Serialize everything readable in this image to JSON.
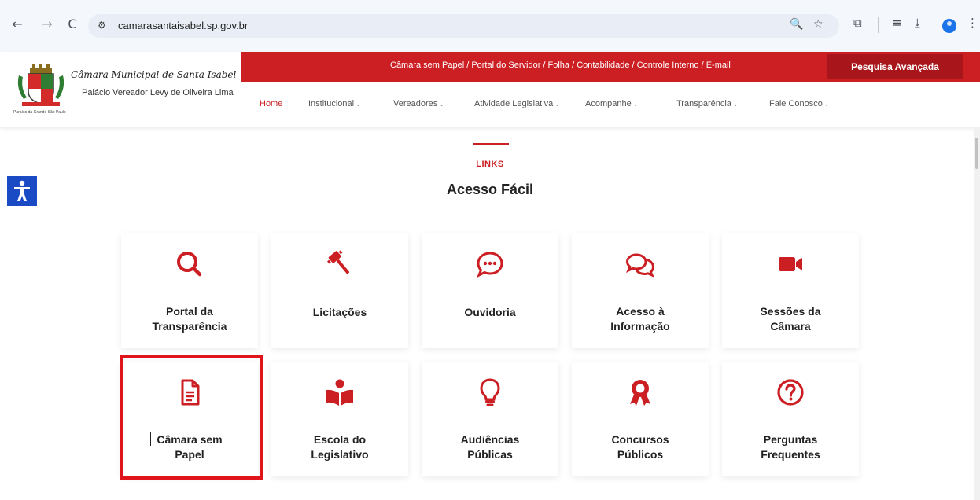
{
  "browser": {
    "url": "camarasantaisabel.sp.gov.br",
    "back_icon": "←",
    "forward_icon": "→",
    "reload_icon": "C",
    "site_info_icon": "⚙",
    "zoom_icon": "🔍",
    "star_icon": "☆",
    "extensions_icon": "⧉",
    "media_icon": "≡",
    "download_icon": "⤓",
    "menu_icon": "⋮"
  },
  "site": {
    "org_name": "Câmara Municipal de Santa Isabel",
    "org_sub": "Palácio Vereador Levy de Oliveira Lima",
    "crest_caption": "Paraíso da Grande São Paulo",
    "top_links": "Câmara sem Papel  /  Portal do Servidor  /  Folha  /  Contabilidade  /  Controle Interno  /  E-mail",
    "advanced_search": "Pesquisa Avançada",
    "nav": [
      {
        "label": "Home",
        "active": true
      },
      {
        "label": "Institucional",
        "caret": "⌄"
      },
      {
        "label": "Vereadores",
        "caret": "⌄"
      },
      {
        "label": "Atividade Legislativa",
        "caret": "⌄"
      },
      {
        "label": "Acompanhe",
        "caret": "⌄"
      },
      {
        "label": "Transparência",
        "caret": "⌄"
      },
      {
        "label": "Fale Conosco",
        "caret": "⌄"
      }
    ],
    "brand_color": "#cc1f24"
  },
  "section": {
    "eyebrow": "LINKS",
    "title": "Acesso Fácil"
  },
  "cards": [
    {
      "label": "Portal da\nTransparência",
      "icon": "search-icon"
    },
    {
      "label": "Licitações",
      "icon": "gavel-icon"
    },
    {
      "label": "Ouvidoria",
      "icon": "chat-dots-icon"
    },
    {
      "label": "Acesso à\nInformação",
      "icon": "comments-icon"
    },
    {
      "label": "Sessões da\nCâmara",
      "icon": "video-camera-icon"
    },
    {
      "label": "Câmara sem\nPapel",
      "icon": "document-icon"
    },
    {
      "label": "Escola do\nLegislativo",
      "icon": "reader-icon"
    },
    {
      "label": "Audiências\nPúblicas",
      "icon": "lightbulb-icon"
    },
    {
      "label": "Concursos\nPúblicos",
      "icon": "award-icon"
    },
    {
      "label": "Perguntas\nFrequentes",
      "icon": "question-icon"
    }
  ]
}
